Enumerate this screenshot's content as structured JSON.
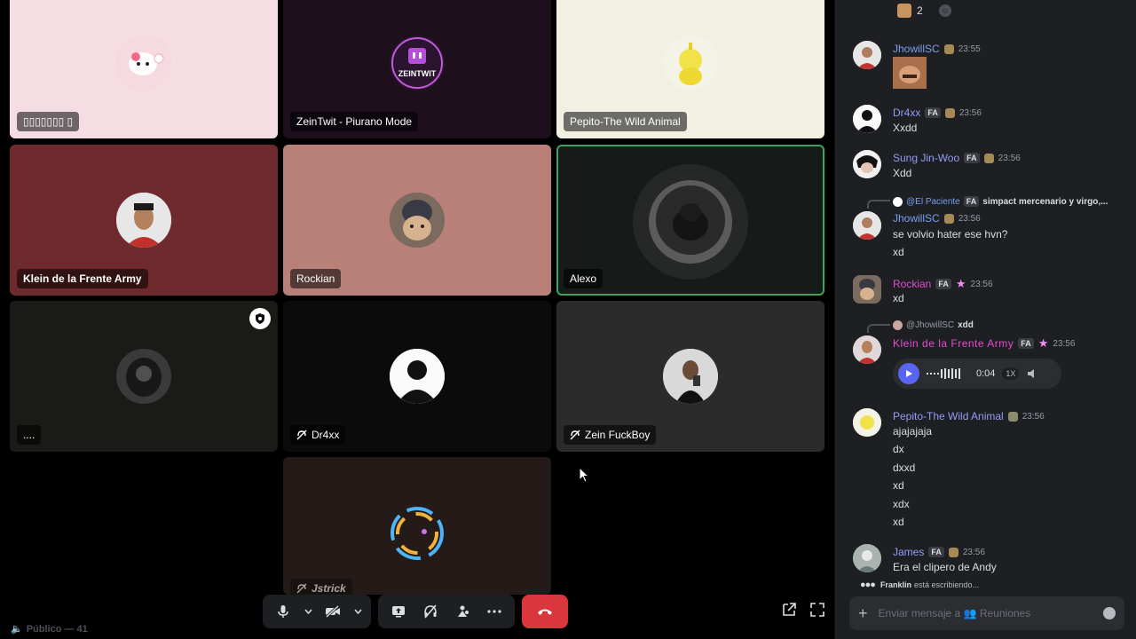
{
  "tiles": [
    {
      "name": "▯▯▯▯▯▯▯ ▯",
      "bg": "#f6dde4"
    },
    {
      "name": "ZeinTwit - Piurano Mode",
      "bg": "#1d0f1c"
    },
    {
      "name": "Pepito-The Wild Animal",
      "bg": "#f1f0e3"
    },
    {
      "name": "Klein de la Frente Army",
      "bg": "#6e2a2c"
    },
    {
      "name": "Rockian",
      "bg": "#b98079"
    },
    {
      "name": "Alexo",
      "bg": "#161b19",
      "speaking": true
    },
    {
      "name": "....",
      "bg": "#1a1b17"
    },
    {
      "name": "Dr4xx",
      "bg": "#0b0b0b",
      "muted": true
    },
    {
      "name": "Zein FuckBoy",
      "bg": "#2b2b2b",
      "muted": true
    },
    {
      "name": "Jstrick",
      "bg": "#241b18",
      "muted": true
    }
  ],
  "avatar_texts": {
    "zeintwit": "ZEINTWIT"
  },
  "footer": {
    "channel": "Público — 41"
  },
  "chat": {
    "reaction_count": "2",
    "messages": [
      {
        "user": "JhowillSC",
        "color": "#7b9ef0",
        "time": "23:55"
      },
      {
        "user": "Dr4xx",
        "color": "#949cf7",
        "tag": "FA",
        "time": "23:56",
        "lines": [
          "Xxdd"
        ]
      },
      {
        "user": "Sung Jin-Woo",
        "color": "#949cf7",
        "tag": "FA",
        "time": "23:56",
        "lines": [
          "Xdd"
        ]
      },
      {
        "reply_user": "@El Paciente",
        "reply_tag": "FA",
        "reply_text": "simpact mercenario y virgo,...",
        "user": "JhowillSC",
        "color": "#7b9ef0",
        "time": "23:56",
        "lines": [
          "se volvio hater ese hvn?",
          "xd"
        ]
      },
      {
        "user": "Rockian",
        "color": "#e44cd3",
        "tag": "FA",
        "time": "23:56",
        "lines": [
          "xd"
        ]
      },
      {
        "reply_user": "@JhowillSC",
        "reply_text": "xdd",
        "user": "Klein de la Frente Army",
        "color": "#e44cd3",
        "tag": "FA",
        "time": "23:56",
        "voice": {
          "duration": "0:04",
          "speed": "1X"
        }
      },
      {
        "user": "Pepito-The Wild Animal",
        "color": "#949cf7",
        "time": "23:56",
        "lines": [
          "ajajajaja",
          "dx",
          "dxxd",
          "xd",
          "xdx",
          "xd"
        ]
      },
      {
        "user": "James",
        "color": "#949cf7",
        "tag": "FA",
        "time": "23:56",
        "lines": [
          "Era el clipero de Andy"
        ]
      }
    ],
    "typing_user": "Franklin",
    "typing_text": "está escribiendo...",
    "composer_placeholder": "Enviar mensaje a 👥 Reuniones"
  }
}
